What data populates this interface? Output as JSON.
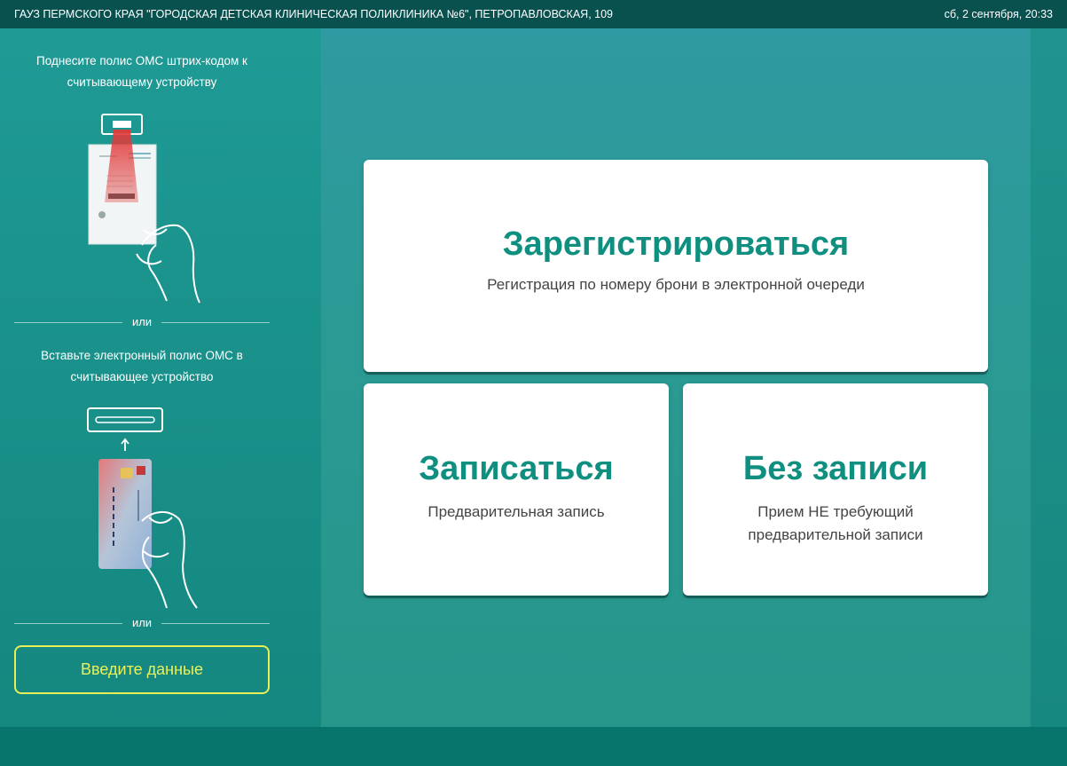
{
  "topbar": {
    "organization": "ГАУЗ ПЕРМСКОГО КРАЯ \"ГОРОДСКАЯ ДЕТСКАЯ КЛИНИЧЕСКАЯ ПОЛИКЛИНИКА №6\", ПЕТРОПАВЛОВСКАЯ, 109",
    "datetime": "сб, 2 сентября, 20:33"
  },
  "left_panel": {
    "scan_instruction": "Поднесите полис ОМС штрих-кодом к считывающему устройству",
    "divider_1": "или",
    "insert_instruction": "Вставьте электронный полис ОМС в считывающее устройство",
    "divider_2": "или",
    "enter_data_button": "Введите данные",
    "illustrations": {
      "scan": "barcode-scan-illustration",
      "card": "card-insert-illustration"
    }
  },
  "main": {
    "register": {
      "title": "Зарегистрироваться",
      "subtitle": "Регистрация по номеру брони в электронной очереди"
    },
    "book": {
      "title": "Записаться",
      "subtitle": "Предварительная запись"
    },
    "walkin": {
      "title": "Без записи",
      "subtitle": "Прием НЕ требующий предварительной записи"
    }
  },
  "colors": {
    "topbar": "#08514f",
    "panel": "#1a908a",
    "accent_title": "#0f8f7f",
    "button_border": "#e6ef56",
    "tile_bg": "#ffffff"
  }
}
